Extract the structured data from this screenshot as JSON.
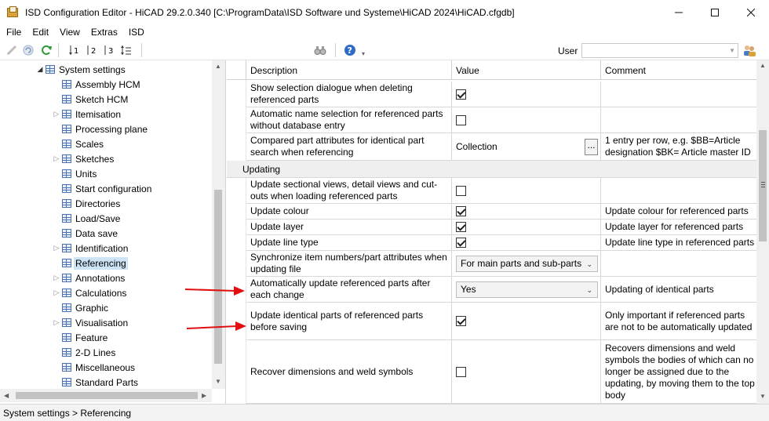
{
  "window": {
    "title": "ISD Configuration Editor  -  HiCAD 29.2.0.340 [C:\\ProgramData\\ISD Software und Systeme\\HiCAD 2024\\HiCAD.cfgdb]"
  },
  "menu": [
    "File",
    "Edit",
    "View",
    "Extras",
    "ISD"
  ],
  "toolbar": {
    "user_label": "User",
    "user_value": "",
    "icons": [
      "pencil-icon",
      "undo-icon",
      "refresh-icon",
      "sort-1-icon",
      "sort-2-icon",
      "sort-3-icon",
      "sort-expand-icon",
      "binoculars-icon",
      "help-icon",
      "user-group-icon"
    ]
  },
  "tree": {
    "root": "System settings",
    "items": [
      {
        "label": "Assembly HCM",
        "expandable": false
      },
      {
        "label": "Sketch HCM",
        "expandable": false
      },
      {
        "label": "Itemisation",
        "expandable": true
      },
      {
        "label": "Processing plane",
        "expandable": false
      },
      {
        "label": "Scales",
        "expandable": false
      },
      {
        "label": "Sketches",
        "expandable": true
      },
      {
        "label": "Units",
        "expandable": false
      },
      {
        "label": "Start configuration",
        "expandable": false
      },
      {
        "label": "Directories",
        "expandable": false
      },
      {
        "label": "Load/Save",
        "expandable": false
      },
      {
        "label": "Data save",
        "expandable": false
      },
      {
        "label": "Identification",
        "expandable": true
      },
      {
        "label": "Referencing",
        "expandable": false,
        "selected": true
      },
      {
        "label": "Annotations",
        "expandable": true
      },
      {
        "label": "Calculations",
        "expandable": true
      },
      {
        "label": "Graphic",
        "expandable": false
      },
      {
        "label": "Visualisation",
        "expandable": true
      },
      {
        "label": "Feature",
        "expandable": false
      },
      {
        "label": "2-D Lines",
        "expandable": false
      },
      {
        "label": "Miscellaneous",
        "expandable": false
      },
      {
        "label": "Standard Parts",
        "expandable": false
      }
    ]
  },
  "grid": {
    "headers": {
      "description": "Description",
      "value": "Value",
      "comment": "Comment"
    },
    "rows_before": [
      {
        "desc": "Show selection dialogue when deleting referenced parts",
        "type": "check",
        "checked": true,
        "comment": ""
      },
      {
        "desc": "Automatic name selection for referenced parts without database entry",
        "type": "check",
        "checked": false,
        "comment": ""
      },
      {
        "desc": "Compared part attributes for identical part search when referencing",
        "type": "button",
        "value": "Collection",
        "button_label": "...",
        "comment": "1 entry per row, e.g. $BB=Article designation $BK= Article master ID"
      }
    ],
    "section": "Updating",
    "rows_after": [
      {
        "desc": "Update sectional views, detail views and cut-outs when loading referenced parts",
        "type": "check",
        "checked": false,
        "comment": ""
      },
      {
        "desc": "Update colour",
        "type": "check",
        "checked": true,
        "comment": "Update colour for referenced parts"
      },
      {
        "desc": "Update layer",
        "type": "check",
        "checked": true,
        "comment": "Update layer for referenced parts"
      },
      {
        "desc": "Update line type",
        "type": "check",
        "checked": true,
        "comment": "Update line type in referenced parts"
      },
      {
        "desc": "Synchronize item numbers/part attributes when updating file",
        "type": "select",
        "value": "For main parts and sub-parts",
        "comment": ""
      },
      {
        "desc": "Automatically update referenced parts after each change",
        "type": "select",
        "value": "Yes",
        "comment": "Updating of identical parts"
      },
      {
        "desc": "Update identical parts of referenced parts before saving",
        "type": "check",
        "checked": true,
        "comment": "Only important if referenced parts are not to be automatically updated"
      },
      {
        "desc": "Recover dimensions and weld symbols",
        "type": "check",
        "checked": false,
        "comment": "Recovers dimensions and weld symbols the bodies of which can no longer be assigned due to the updating, by moving them to the top body"
      }
    ]
  },
  "status": {
    "breadcrumb": "System settings > Referencing"
  },
  "colors": {
    "selection": "#cde4f7",
    "annotation_arrow": "#e01010",
    "tree_icon": "#4a72b0"
  }
}
